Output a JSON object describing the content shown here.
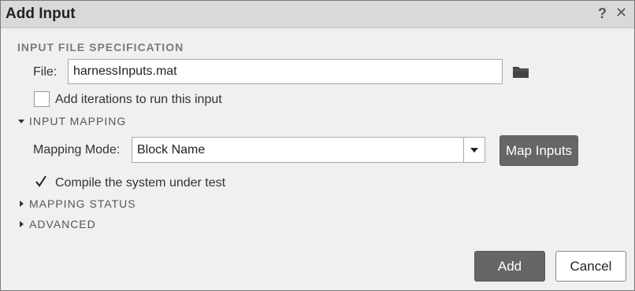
{
  "dialog": {
    "title": "Add Input",
    "help_glyph": "?",
    "close_glyph": "✕"
  },
  "input_file_spec": {
    "heading": "INPUT FILE SPECIFICATION",
    "file_label": "File:",
    "file_value": "harnessInputs.mat",
    "browse_icon": "folder-icon",
    "iterations_label": "Add iterations to run this input",
    "iterations_checked": false
  },
  "input_mapping": {
    "heading": "INPUT MAPPING",
    "expanded": true,
    "mode_label": "Mapping Mode:",
    "mode_value": "Block Name",
    "map_button": "Map Inputs",
    "compile_label": "Compile the system under test",
    "compile_checked": true
  },
  "mapping_status": {
    "heading": "MAPPING STATUS",
    "expanded": false
  },
  "advanced": {
    "heading": "ADVANCED",
    "expanded": false
  },
  "footer": {
    "add_label": "Add",
    "cancel_label": "Cancel"
  },
  "colors": {
    "title_bar": "#d9d9d9",
    "dialog_bg": "#f0f0f0",
    "primary_button": "#666666"
  }
}
